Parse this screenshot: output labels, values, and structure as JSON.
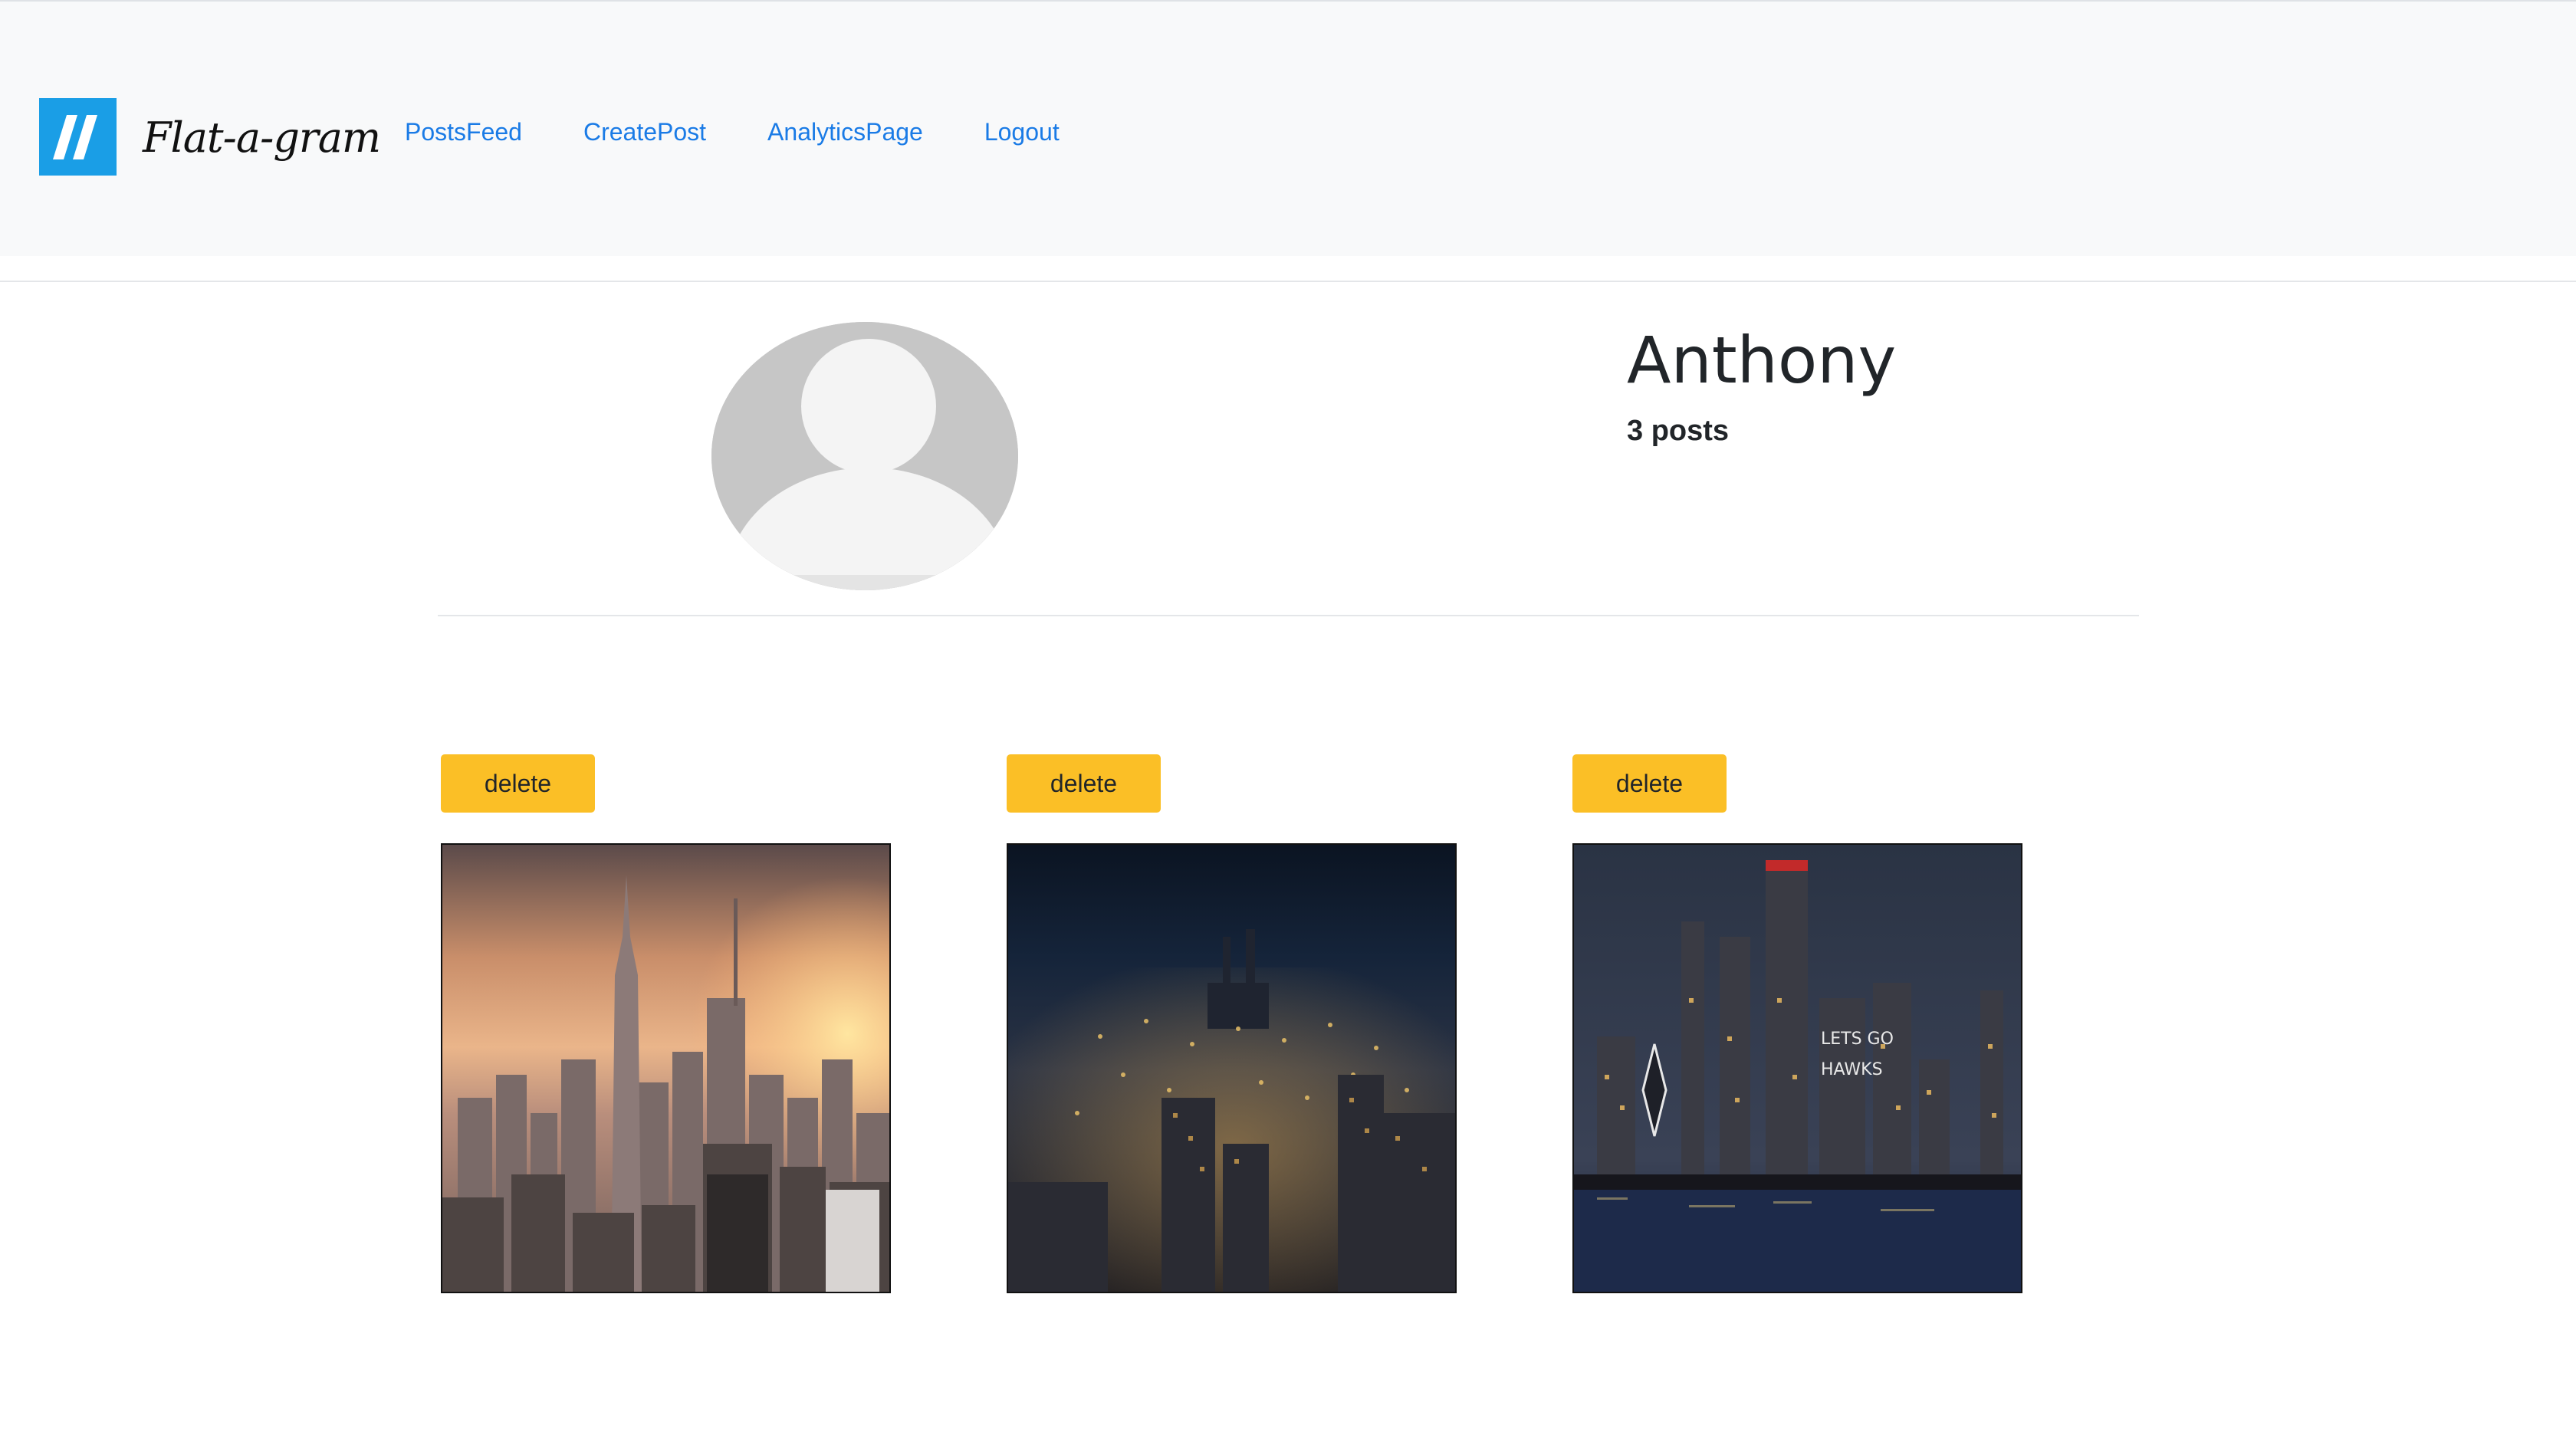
{
  "brand": {
    "name": "Flat-a-gram",
    "logo_icon": "double-slash-logo-icon",
    "logo_color": "#1a9ee6"
  },
  "nav": {
    "links": [
      {
        "label": "PostsFeed"
      },
      {
        "label": "CreatePost"
      },
      {
        "label": "AnalyticsPage"
      },
      {
        "label": "Logout"
      }
    ],
    "link_color": "#1a7be6"
  },
  "profile": {
    "avatar_icon": "default-user-avatar-icon",
    "name": "Anthony",
    "posts_count": "3 posts"
  },
  "posts": [
    {
      "delete_label": "delete",
      "image": "city-skyline-sunset-photo"
    },
    {
      "delete_label": "delete",
      "image": "city-night-aerial-photo"
    },
    {
      "delete_label": "delete",
      "image": "city-skyline-waterfront-night-photo"
    }
  ],
  "colors": {
    "navbar_bg": "#f8f9fa",
    "delete_button": "#fbbf26",
    "text": "#212529"
  }
}
